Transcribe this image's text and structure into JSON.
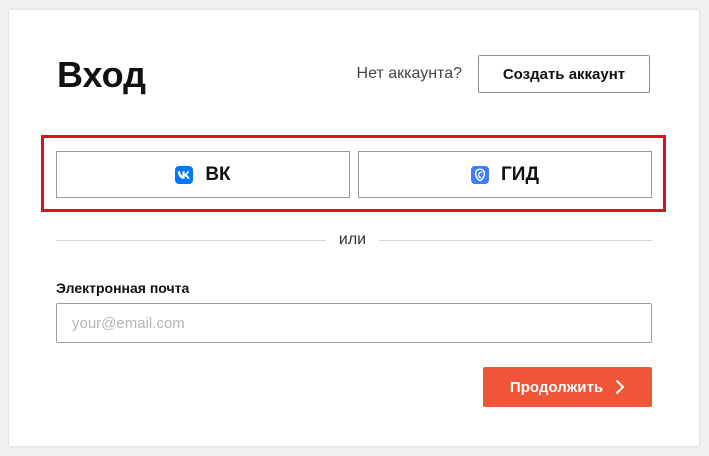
{
  "header": {
    "title": "Вход",
    "no_account_text": "Нет аккаунта?",
    "create_account_label": "Создать аккаунт"
  },
  "social": {
    "highlight_color": "#d9121c",
    "vk": {
      "label": "ВК",
      "icon": "vk-logo-icon",
      "color": "#0077ff"
    },
    "gid": {
      "label": "ГИД",
      "icon": "gid-logo-icon",
      "color": "#3b7ef6"
    }
  },
  "divider": {
    "text": "или"
  },
  "form": {
    "email_label": "Электронная почта",
    "email_value": "",
    "email_placeholder": "your@email.com"
  },
  "actions": {
    "continue_label": "Продолжить",
    "continue_icon": "chevron-right-icon",
    "continue_color": "#f05537"
  }
}
